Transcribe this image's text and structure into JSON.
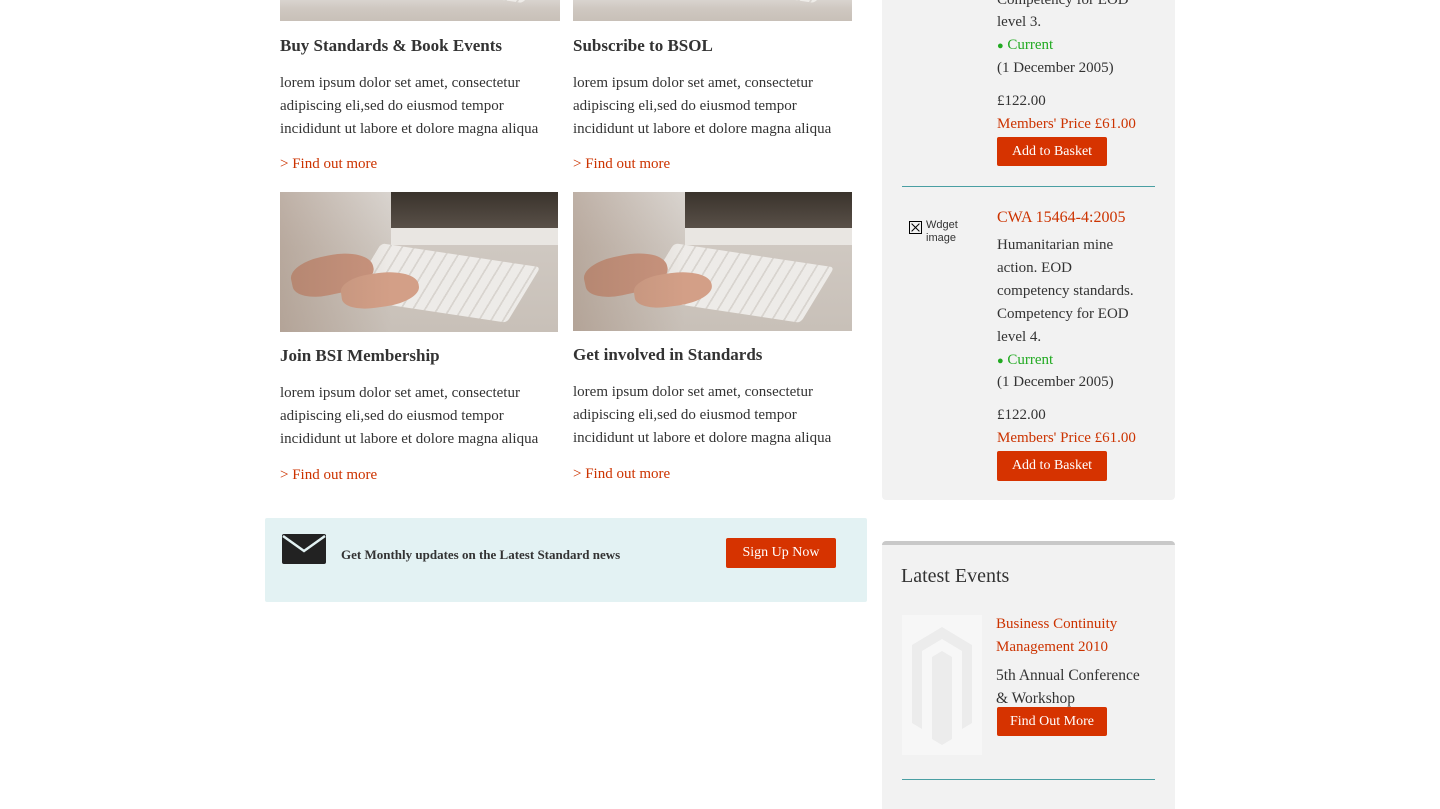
{
  "cards": [
    {
      "title": "Buy Standards & Book Events",
      "text": [
        "lorem ipsum dolor set amet, consectetur",
        "adipiscing eli,sed do eiusmod tempor",
        "incididunt ut labore et dolore magna aliqua"
      ],
      "link": "> Find out more"
    },
    {
      "title": "Subscribe to BSOL",
      "text": [
        "lorem ipsum dolor set amet, consectetur",
        "adipiscing eli,sed do eiusmod tempor",
        "incididunt ut labore et dolore magna aliqua"
      ],
      "link": "> Find out more"
    },
    {
      "title": "Join BSI Membership",
      "text": [
        "lorem ipsum dolor set amet, consectetur",
        "adipiscing eli,sed do eiusmod tempor",
        "incididunt ut labore et dolore magna aliqua"
      ],
      "link": "> Find out more"
    },
    {
      "title": "Get involved in Standards",
      "text": [
        "lorem ipsum dolor set amet, consectetur",
        "adipiscing eli,sed do eiusmod tempor",
        "incididunt ut labore et dolore magna aliqua"
      ],
      "link": "> Find out more"
    }
  ],
  "newsletter": {
    "text": "Get Monthly updates on the Latest Standard news",
    "button": "Sign Up Now",
    "icon": "envelope-icon"
  },
  "products": [
    {
      "desc_lines": [
        "Competency for EOD",
        "level 3."
      ],
      "status": "Current",
      "date": "(1 December 2005)",
      "price": "£122.00",
      "members_price": "Members' Price £61.00",
      "button": "Add to Basket"
    },
    {
      "widget_alt": [
        "Wdget",
        "image"
      ],
      "code": "CWA 15464-4:2005",
      "desc_lines": [
        "Humanitarian mine",
        "action. EOD",
        "competency standards.",
        "Competency for EOD",
        "level 4."
      ],
      "status": "Current",
      "date": "(1 December 2005)",
      "price": "£122.00",
      "members_price": "Members' Price £61.00",
      "button": "Add to Basket"
    }
  ],
  "events": {
    "heading": "Latest Events",
    "items": [
      {
        "title_lines": [
          "Business Continuity",
          "Management 2010"
        ],
        "desc_lines": [
          "5th Annual Conference",
          "& Workshop"
        ],
        "button": "Find Out More"
      }
    ]
  },
  "colors": {
    "accent": "#d63300",
    "link": "#cc3300",
    "status_green": "#22aa22",
    "newsletter_bg": "#e3f2f3",
    "sidebar_bg": "#f2f2f2",
    "divider": "#4a9fa3"
  }
}
